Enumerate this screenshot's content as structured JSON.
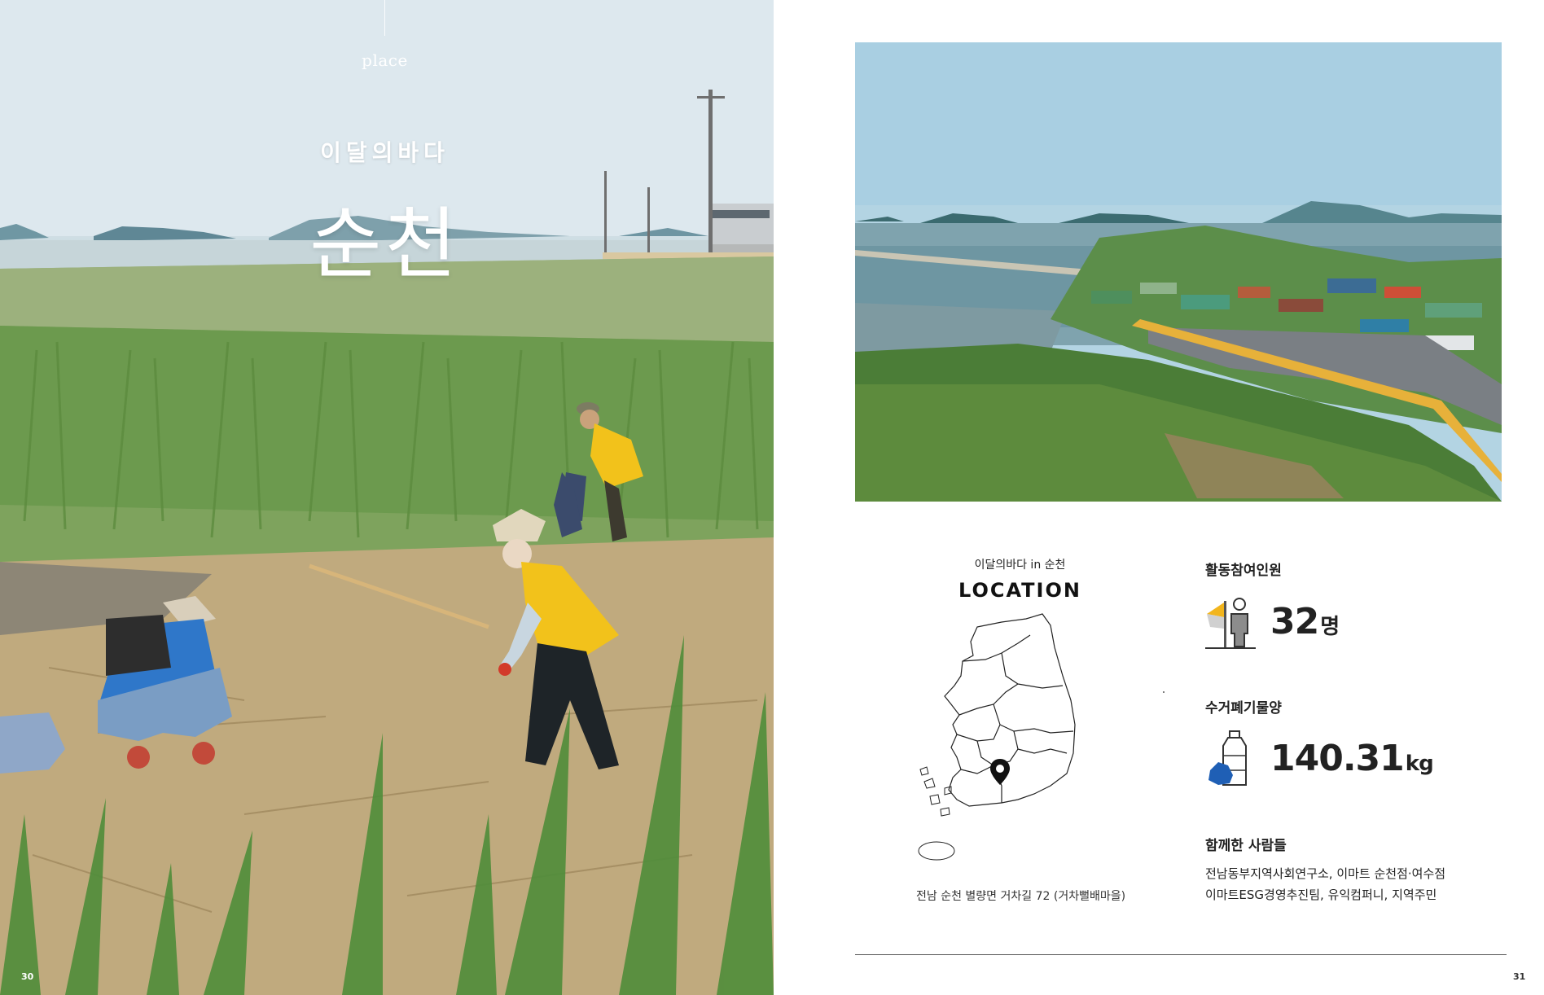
{
  "left_page": {
    "place_label": "place",
    "section_label": "이달의바다",
    "title": "순천",
    "page_number": "30"
  },
  "right_page": {
    "page_number": "31",
    "location": {
      "subtitle": "이달의바다 in 순천",
      "heading": "LOCATION",
      "address": "전남 순천 별량면 거차길 72 (거차뻘배마을)"
    },
    "stats": {
      "participants": {
        "label": "활동참여인원",
        "value": "32",
        "unit": "명"
      },
      "waste": {
        "label": "수거폐기물양",
        "value": "140.31",
        "unit": "kg"
      }
    },
    "partners": {
      "label": "함께한 사람들",
      "line1": "전남동부지역사회연구소, 이마트 순천점·여수점",
      "line2": "이마트ESG경영추진팀, 유익컴퍼니, 지역주민"
    }
  },
  "colors": {
    "accent_yellow": "#f2b51d",
    "accent_blue": "#1f5fb5",
    "text": "#222222"
  },
  "icons": [
    "flag-person-icon",
    "bottle-bag-icon",
    "map-pin-icon"
  ]
}
